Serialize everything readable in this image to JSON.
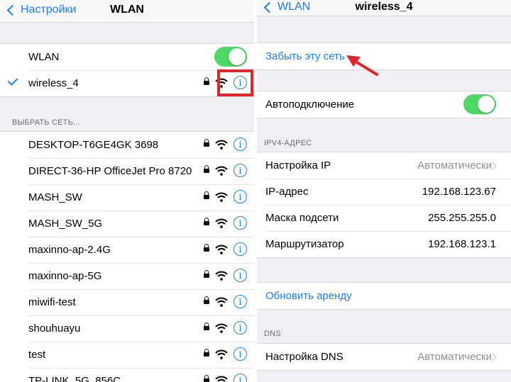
{
  "left": {
    "nav": {
      "back_label": "Настройки",
      "title": "WLAN"
    },
    "wlan_row": {
      "label": "WLAN",
      "toggle_on": true
    },
    "connected_network": {
      "name": "wireless_4",
      "secured": true
    },
    "choose_header": "ВЫБРАТЬ СЕТЬ...",
    "networks": [
      {
        "name": "DESKTOP-T6GE4GK 3698",
        "secured": true
      },
      {
        "name": "DIRECT-36-HP OfficeJet Pro 8720",
        "secured": true
      },
      {
        "name": "MASH_SW",
        "secured": true
      },
      {
        "name": "MASH_SW_5G",
        "secured": true
      },
      {
        "name": "maxinno-ap-2.4G",
        "secured": true
      },
      {
        "name": "maxinno-ap-5G",
        "secured": true
      },
      {
        "name": "miwifi-test",
        "secured": true
      },
      {
        "name": "shouhuayu",
        "secured": true
      },
      {
        "name": "test",
        "secured": true
      },
      {
        "name": "TP-LINK_5G_856C",
        "secured": true
      }
    ]
  },
  "right": {
    "nav": {
      "back_label": "WLAN",
      "title": "wireless_4"
    },
    "forget_label": "Забыть эту сеть",
    "autojoin": {
      "label": "Автоподключение",
      "toggle_on": true
    },
    "ipv4_header": "IPV4-АДРЕС",
    "ipv4_rows": [
      {
        "label": "Настройка IP",
        "value": "Автоматически"
      },
      {
        "label": "IP-адрес",
        "value": "192.168.123.67"
      },
      {
        "label": "Маска подсети",
        "value": "255.255.255.0"
      },
      {
        "label": "Маршрутизатор",
        "value": "192.168.123.1"
      }
    ],
    "renew_label": "Обновить аренду",
    "dns_header": "DNS",
    "dns_row": {
      "label": "Настройка DNS",
      "value": "Автоматически"
    }
  },
  "icons": {
    "lock": "lock-icon",
    "wifi": "wifi-icon",
    "info": "info-icon",
    "check": "checkmark-icon",
    "back": "chevron-left-icon"
  },
  "colors": {
    "accent": "#1a7ef5",
    "toggle_on": "#4cd964",
    "highlight": "#e2242b",
    "group_bg": "#efeff4"
  }
}
